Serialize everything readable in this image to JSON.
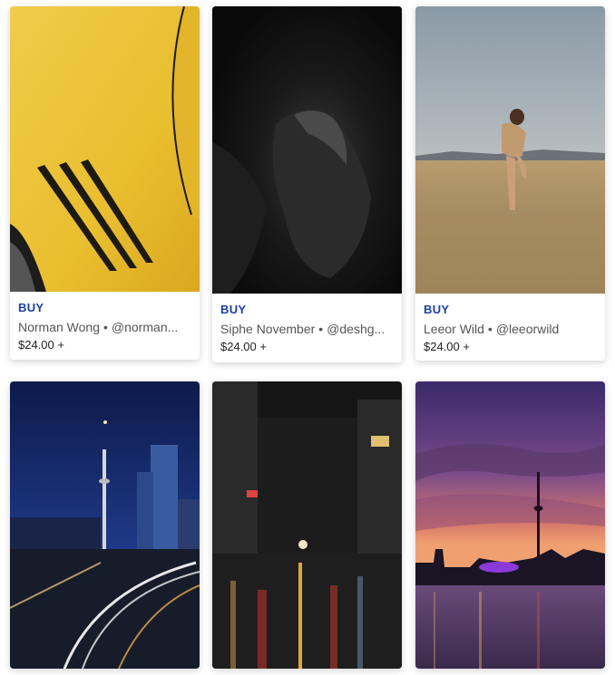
{
  "cards": [
    {
      "buy_label": "BUY",
      "author": "Norman Wong",
      "handle": "@norman...",
      "price": "$24.00 +",
      "image": "yellow-car-vents"
    },
    {
      "buy_label": "BUY",
      "author": "Siphe November",
      "handle": "@deshg...",
      "price": "$24.00 +",
      "image": "dark-portrait"
    },
    {
      "buy_label": "BUY",
      "author": "Leeor Wild",
      "handle": "@leeorwild",
      "price": "$24.00 +",
      "image": "woman-in-field"
    },
    {
      "image": "city-night-skyline-train-lights"
    },
    {
      "image": "rainy-street-night"
    },
    {
      "image": "sunset-tower-over-lake"
    }
  ],
  "separator": "•",
  "colors": {
    "buy": "#1a3fa6",
    "author": "#555555",
    "price": "#222222"
  }
}
